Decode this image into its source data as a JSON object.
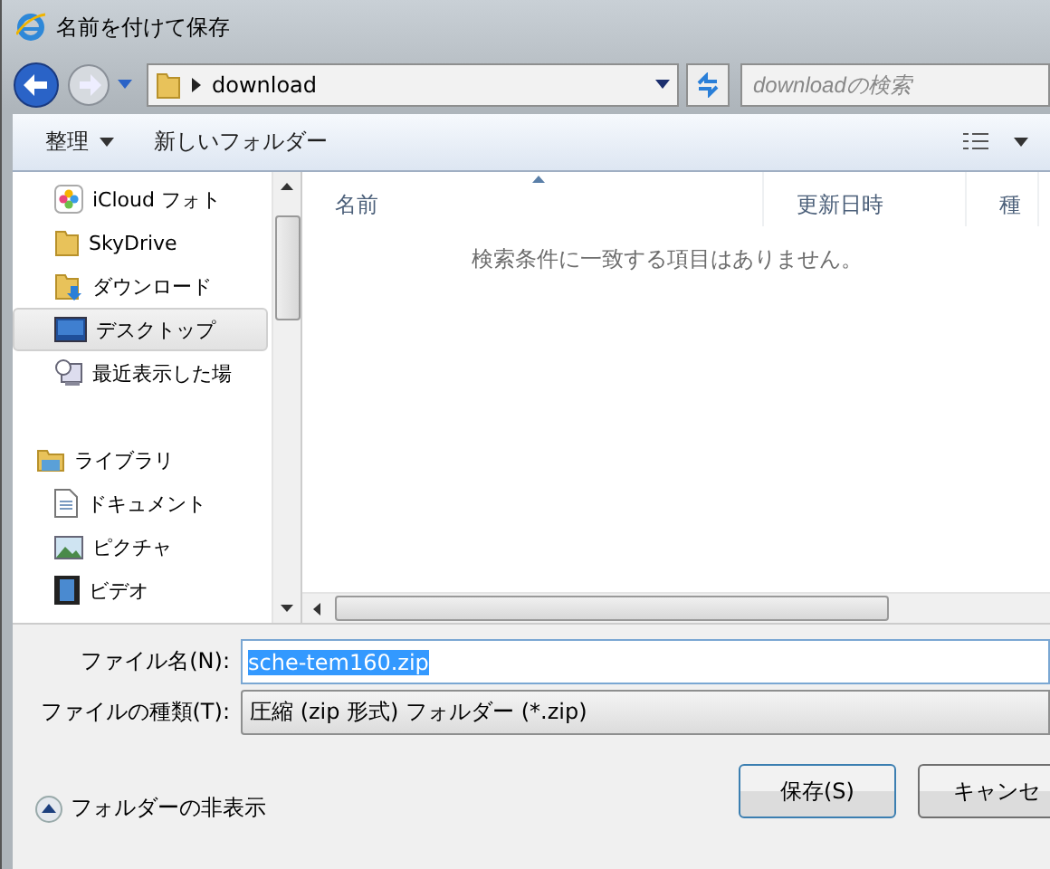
{
  "window": {
    "title": "名前を付けて保存"
  },
  "address": {
    "path": "download"
  },
  "search": {
    "placeholder": "downloadの検索"
  },
  "toolbar": {
    "organize": "整理",
    "new_folder": "新しいフォルダー"
  },
  "nav_pane": {
    "groups": [
      {
        "items": [
          {
            "label": "iCloud フォト",
            "kind": "photos",
            "selected": false
          },
          {
            "label": "SkyDrive",
            "kind": "folder",
            "selected": false
          },
          {
            "label": "ダウンロード",
            "kind": "download",
            "selected": false
          },
          {
            "label": "デスクトップ",
            "kind": "desktop",
            "selected": true
          },
          {
            "label": "最近表示した場",
            "kind": "recent",
            "selected": false
          }
        ]
      },
      {
        "label": "ライブラリ",
        "kind": "library",
        "items": [
          {
            "label": "ドキュメント",
            "kind": "document",
            "selected": false
          },
          {
            "label": "ピクチャ",
            "kind": "picture",
            "selected": false
          },
          {
            "label": "ビデオ",
            "kind": "video",
            "selected": false
          }
        ]
      }
    ]
  },
  "file_list": {
    "columns": [
      {
        "label": "名前",
        "sorted": true
      },
      {
        "label": "更新日時",
        "sorted": false
      },
      {
        "label": "種",
        "sorted": false
      }
    ],
    "empty_message": "検索条件に一致する項目はありません。"
  },
  "file_name": {
    "label": "ファイル名(N):",
    "value": "sche-tem160.zip",
    "selected": true
  },
  "file_type": {
    "label": "ファイルの種類(T):",
    "value": "圧縮 (zip 形式) フォルダー (*.zip)"
  },
  "hide_folders": "フォルダーの非表示",
  "buttons": [
    {
      "label": "保存(S)",
      "kind": "default"
    },
    {
      "label": "キャンセ",
      "kind": "normal"
    }
  ]
}
